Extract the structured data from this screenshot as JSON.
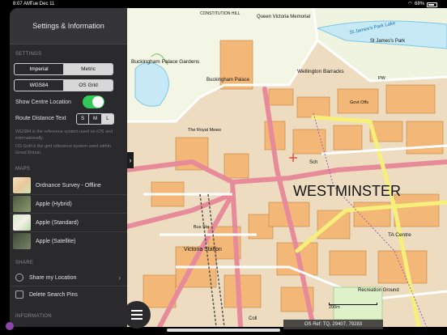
{
  "status": {
    "time": "8:07 AM",
    "date": "Tue Dec 11",
    "battery": "68%"
  },
  "sidebar": {
    "title": "Settings & Information",
    "settings_label": "SETTINGS",
    "units": {
      "options": [
        "Imperial",
        "Metric"
      ],
      "selected": "Metric"
    },
    "grid": {
      "options": [
        "WGS84",
        "OS Grid"
      ],
      "selected": "OS Grid"
    },
    "show_centre_location": {
      "label": "Show Centre Location",
      "on": true
    },
    "route_distance": {
      "label": "Route Distance Text",
      "options": [
        "S",
        "M",
        "L"
      ],
      "selected": "L"
    },
    "info_text_1": "WGS84 is the reference system used on iOS and internationally.",
    "info_text_2": "OS Grid is the grid reference system used within Great Britain.",
    "maps_label": "MAPS",
    "maps": [
      {
        "label": "Ordnance Survey - Offline",
        "thumb": "os-thumb"
      },
      {
        "label": "Apple (Hybrid)",
        "thumb": "hybrid-thumb"
      },
      {
        "label": "Apple (Standard)",
        "thumb": "standard-thumb"
      },
      {
        "label": "Apple (Satellite)",
        "thumb": "satellite-thumb"
      }
    ],
    "share_label": "SHARE",
    "share_my_location": "Share my Location",
    "delete_search_pins": "Delete Search Pins",
    "information_label": "INFORMATION"
  },
  "map": {
    "labels": {
      "queen_victoria": "Queen Victoria\nMemorial",
      "constitution_hill": "CONSTITUTION HILL",
      "st_james_park": "St James's Park",
      "st_james_park_lake": "St James's Park Lake",
      "buckingham_gardens": "Buckingham Palace Gardens",
      "buckingham_palace": "Buckingham\nPalace",
      "wellington_barracks": "Wellington Barracks",
      "govt_offs": "Govt\nOffs",
      "royal_mews": "The Royal\nMews",
      "westminster": "WESTMINSTER",
      "victoria_station": "Victoria Station",
      "bus_sta": "Bus\nSta",
      "recreation_ground": "Recreation Ground",
      "ta_centre": "TA Centre",
      "sch": "Sch",
      "coll": "Coll",
      "pw": "PW"
    },
    "os_ref": "OS Ref: TQ, 29407, 79283",
    "scale_label": "200m"
  },
  "colors": {
    "accent_green": "#34c759",
    "sidebar_bg": "#2a2a2c",
    "road_pink": "#e78a9a",
    "building_orange": "#f3b877",
    "road_yellow": "#f6f07a"
  }
}
